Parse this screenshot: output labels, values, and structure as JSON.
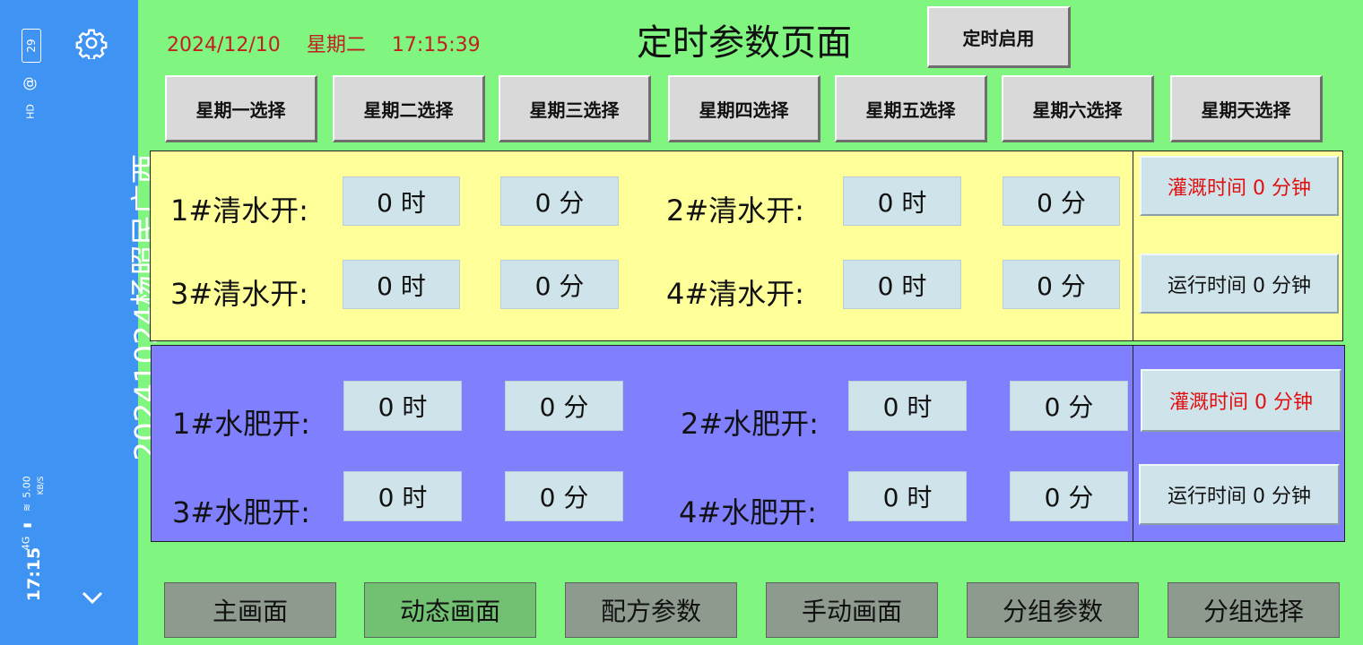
{
  "status_bar": {
    "time": "17:15",
    "network": "4G",
    "speed": "5.00",
    "speed_unit": "KB/S",
    "battery": "29",
    "hd": "HD"
  },
  "sidebar": {
    "title": "20241024杨照民广西"
  },
  "header": {
    "date": "2024/12/10",
    "weekday": "星期二",
    "time": "17:15:39",
    "title": "定时参数页面",
    "enable_button": "定时启用"
  },
  "day_buttons": [
    "星期一选择",
    "星期二选择",
    "星期三选择",
    "星期四选择",
    "星期五选择",
    "星期六选择",
    "星期天选择"
  ],
  "clean_water": {
    "rows": [
      {
        "label": "1#清水开:",
        "hour": "0 时",
        "minute": "0 分"
      },
      {
        "label": "2#清水开:",
        "hour": "0 时",
        "minute": "0 分"
      },
      {
        "label": "3#清水开:",
        "hour": "0 时",
        "minute": "0 分"
      },
      {
        "label": "4#清水开:",
        "hour": "0 时",
        "minute": "0 分"
      }
    ],
    "irrigation_time": "灌溉时间 0 分钟",
    "run_time": "运行时间 0 分钟"
  },
  "fertilizer": {
    "rows": [
      {
        "label": "1#水肥开:",
        "hour": "0 时",
        "minute": "0 分"
      },
      {
        "label": "2#水肥开:",
        "hour": "0 时",
        "minute": "0 分"
      },
      {
        "label": "3#水肥开:",
        "hour": "0 时",
        "minute": "0 分"
      },
      {
        "label": "4#水肥开:",
        "hour": "0 时",
        "minute": "0 分"
      }
    ],
    "irrigation_time": "灌溉时间 0 分钟",
    "run_time": "运行时间 0 分钟"
  },
  "nav": [
    "主画面",
    "动态画面",
    "配方参数",
    "手动画面",
    "分组参数",
    "分组选择"
  ],
  "colors": {
    "background": "#80f580",
    "sidebar": "#3f93f2",
    "clean_panel": "#ffff9a",
    "fertilizer_panel": "#8080ff",
    "field": "#cfe3ea",
    "red_text": "#e01010",
    "nav_active": "#72c072"
  }
}
